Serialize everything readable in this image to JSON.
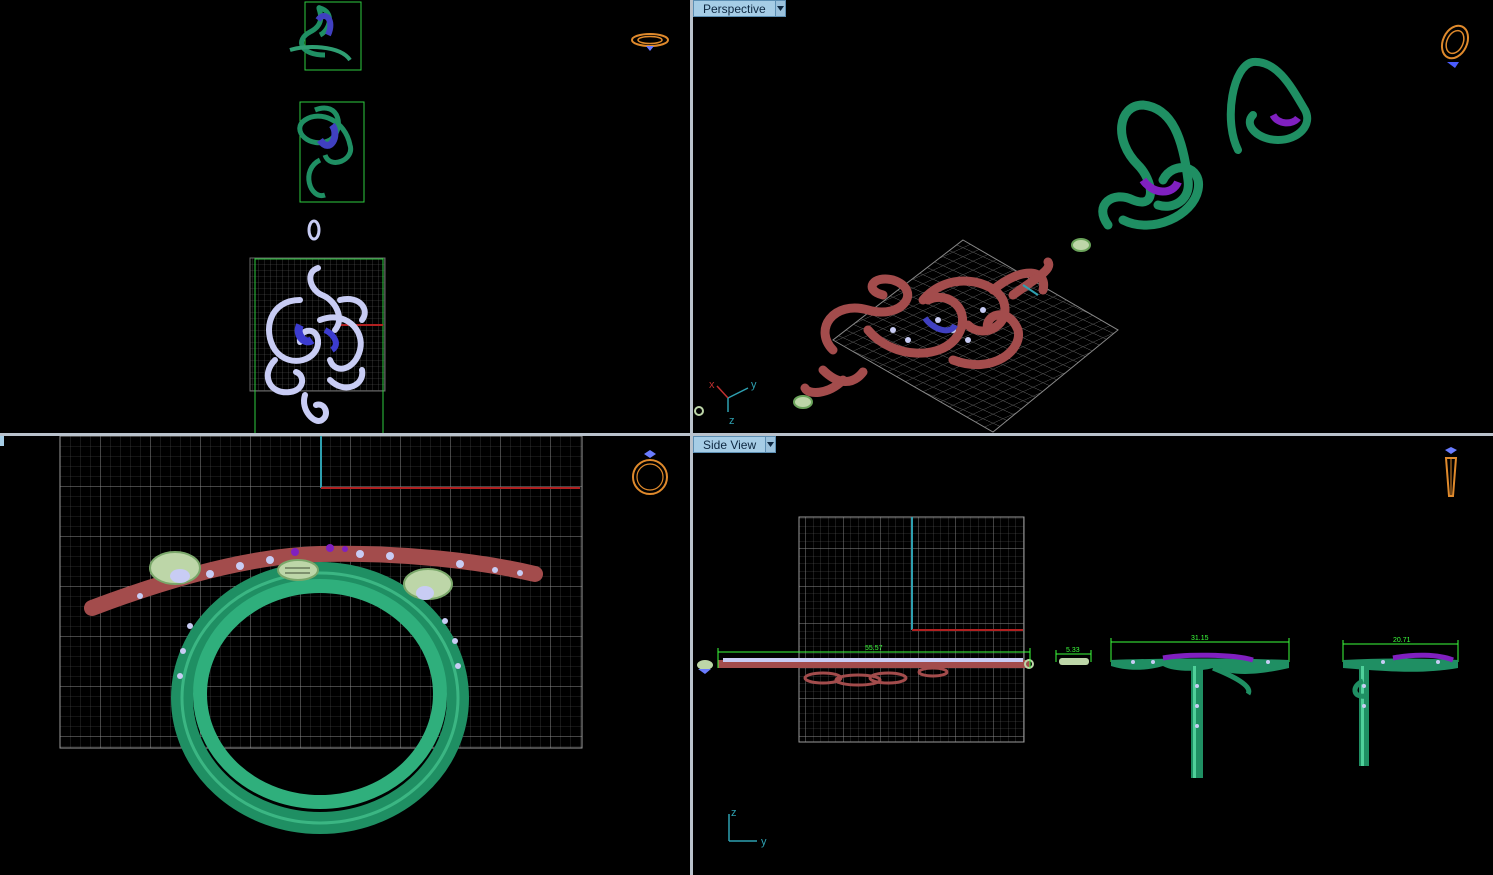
{
  "viewports": {
    "top": {
      "label": "",
      "nav_icon": "ring-top-view-icon"
    },
    "perspective": {
      "label": "Perspective",
      "nav_icon": "ring-perspective-icon",
      "dropdown_icon": "chevron-down-icon"
    },
    "front": {
      "label": "",
      "nav_icon": "ring-front-view-icon"
    },
    "side": {
      "label": "Side View",
      "nav_icon": "ring-side-view-icon",
      "dropdown_icon": "chevron-down-icon"
    }
  },
  "perspective_axes": {
    "x": "x",
    "y": "y",
    "z": "z"
  },
  "side_axes": {
    "z": "z",
    "y": "y"
  },
  "dimensions": {
    "d1": "55.57",
    "d2": "5.33",
    "d3": "31.15",
    "d4": "20.71"
  },
  "colors": {
    "background": "#000000",
    "grid": "#6a6a6a",
    "model_teal": "#1f8f63",
    "model_red": "#a34c4c",
    "stones_light": "#c8ccf4",
    "stones_blue": "#3c3cd0",
    "dimension_green": "#3cff3c",
    "label_bg": "#a6cde6",
    "nav_orange": "#e08a2c"
  }
}
